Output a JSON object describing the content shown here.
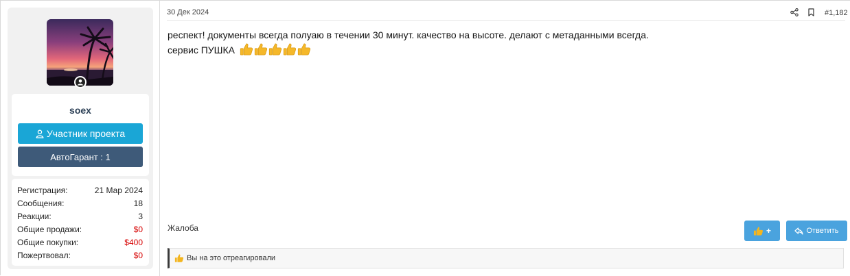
{
  "user": {
    "username": "soex",
    "role_label": "Участник проекта",
    "garant_label": "АвтоГарант : 1",
    "stats": [
      {
        "label": "Регистрация:",
        "value": "21 Мар 2024",
        "highlight": false
      },
      {
        "label": "Сообщения:",
        "value": "18",
        "highlight": false
      },
      {
        "label": "Реакции:",
        "value": "3",
        "highlight": false
      },
      {
        "label": "Общие продажи:",
        "value": "$0",
        "highlight": true
      },
      {
        "label": "Общие покупки:",
        "value": "$400",
        "highlight": true
      },
      {
        "label": "Пожертвовал:",
        "value": "$0",
        "highlight": true
      }
    ]
  },
  "post": {
    "date": "30 Дек 2024",
    "number": "#1,182",
    "line1": "респект! документы всегда полуаю в течении 30 минут. качество на высоте. делают с метаданными всегда.",
    "line2": "сервис ПУШКА",
    "emoji_count": 5,
    "report_label": "Жалоба",
    "like_label": "+",
    "reply_label": "Ответить",
    "reaction_text": "Вы на это отреагировали"
  },
  "colors": {
    "role_button": "#1aa6d6",
    "garant_button": "#3e5a79",
    "action_button": "#4aa3de",
    "money_value": "#d60000"
  },
  "icons": [
    "user-icon",
    "share-icon",
    "bookmark-icon",
    "thumbs-up-icon",
    "reply-icon"
  ]
}
